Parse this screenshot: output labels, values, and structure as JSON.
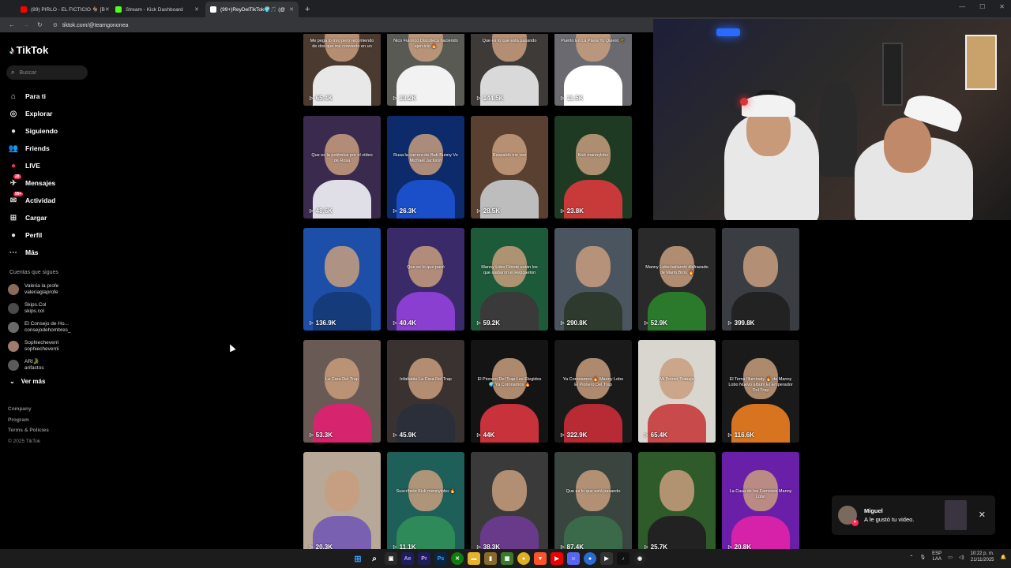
{
  "browser": {
    "tabs": [
      {
        "title": "(89) PIRLO - EL FICTICIO 🐐 [B",
        "favicon_color": "#ff0000",
        "active": false
      },
      {
        "title": "Stream - Kick Dashboard",
        "favicon_color": "#53fc18",
        "active": false
      },
      {
        "title": "(99+)ReyDelTikTok🌍🎵 (@",
        "favicon_color": "#ffffff",
        "active": true
      }
    ],
    "new_tab": "+",
    "url": "tiktok.com/@teamgononea"
  },
  "tiktok": {
    "logo": "TikTok",
    "search_placeholder": "Buscar",
    "nav": [
      {
        "label": "Para ti",
        "icon": "home-icon",
        "glyph": "⌂"
      },
      {
        "label": "Explorar",
        "icon": "compass-icon",
        "glyph": "◎"
      },
      {
        "label": "Siguiendo",
        "icon": "following-icon",
        "glyph": "●"
      },
      {
        "label": "Friends",
        "icon": "friends-icon",
        "glyph": "👥"
      },
      {
        "label": "LIVE",
        "icon": "live-icon",
        "glyph": "●"
      },
      {
        "label": "Mensajes",
        "icon": "messages-icon",
        "glyph": "✈",
        "badge": "28"
      },
      {
        "label": "Actividad",
        "icon": "activity-icon",
        "glyph": "✉",
        "badge": "99+"
      },
      {
        "label": "Cargar",
        "icon": "upload-icon",
        "glyph": "⊞"
      },
      {
        "label": "Perfil",
        "icon": "profile-icon",
        "glyph": "●"
      },
      {
        "label": "Más",
        "icon": "more-icon",
        "glyph": "···"
      }
    ],
    "following_title": "Cuentas que sigues",
    "following": [
      {
        "name": "Valeria la profe",
        "handle": "valeriaglaprofe"
      },
      {
        "name": "Skips.Col",
        "handle": "skips.col"
      },
      {
        "name": "El Consejo de Ho...",
        "handle": "consejodehombres_"
      },
      {
        "name": "Sophiecheverri",
        "handle": "sophiecheverrii"
      },
      {
        "name": "ARI🐊",
        "handle": "arifactos"
      }
    ],
    "ver_mas": "Ver más",
    "footer": [
      "Company",
      "Program",
      "Terms & Policies"
    ],
    "copyright": "© 2025 TikTok"
  },
  "videos": [
    {
      "views": "65.4K",
      "caption": "Me pega lo mío pero recomiendo de dos que me convierto en un",
      "bg": "#4a3a30",
      "shirt": "#e8e8e8"
    },
    {
      "views": "13.2K",
      "caption": "Nico Fulonco Discoteca haciendo ejercicio 🔥",
      "bg": "#5a5a55",
      "shirt": "#f2f2f2"
    },
    {
      "views": "144.5K",
      "caption": "Que es lo que está pasando",
      "bg": "#3e3a38",
      "shirt": "#d9d9d9"
    },
    {
      "views": "11.5K",
      "caption": "Puerto En La Playa Yo Quiero 🌴",
      "bg": "#6a6a70",
      "shirt": "#ffffff"
    },
    {
      "views": "48.6K",
      "caption": "Que es la polémica por el vídeo de Rosa",
      "bg": "#3a2a4e",
      "shirt": "#e0dfe8"
    },
    {
      "views": "26.3K",
      "caption": "Rusa la carrera de Bab Bunny Vs Michael Jackson",
      "bg": "#0d2a6b",
      "shirt": "#1b4fc9"
    },
    {
      "views": "28.5K",
      "caption": "Respaldo me veo",
      "bg": "#5a4030",
      "shirt": "#bdbdbd"
    },
    {
      "views": "23.8K",
      "caption": "Kick mannylobo",
      "bg": "#1f3a22",
      "shirt": "#c83a3a"
    },
    {
      "views": "136.9K",
      "caption": "",
      "bg": "#1d4fa8",
      "shirt": "#163b7a"
    },
    {
      "views": "40.4K",
      "caption": "Que es lo que pasó",
      "bg": "#3b2a6a",
      "shirt": "#8a3fd1"
    },
    {
      "views": "59.2K",
      "caption": "Manny Lobo Dónde están los que alabaron el Reggaeton",
      "bg": "#1d5a3a",
      "shirt": "#3a3a3a"
    },
    {
      "views": "290.8K",
      "caption": "",
      "bg": "#4a5560",
      "shirt": "#2d3a2d"
    },
    {
      "views": "52.9K",
      "caption": "Manny Lobo bailando disfrazado de Mario Bros 🔥",
      "bg": "#2a2a2a",
      "shirt": "#2b7a2b"
    },
    {
      "views": "399.8K",
      "caption": "",
      "bg": "#3a3d42",
      "shirt": "#222"
    },
    {
      "views": "53.3K",
      "caption": "La Cara Del Trap",
      "bg": "#6a5a55",
      "shirt": "#d6246e"
    },
    {
      "views": "45.9K",
      "caption": "Infaltable La Cara Del Trap",
      "bg": "#3a3230",
      "shirt": "#2a2f3a"
    },
    {
      "views": "44K",
      "caption": "El Pionero Del Trap Los Elegidos 🌍 Ya Coronamos 🔥",
      "bg": "#141414",
      "shirt": "#c8323a"
    },
    {
      "views": "322.9K",
      "caption": "Ya Coronamos 🔥 Manny Lobo El Pionero Del Trap",
      "bg": "#1a1a1a",
      "shirt": "#b82a34"
    },
    {
      "views": "65.4K",
      "caption": "Mi Primer Trabajo",
      "bg": "#d9d6d0",
      "shirt": "#c94a4a"
    },
    {
      "views": "116.6K",
      "caption": "El Tema Illuminaty 🔥 de Manny Lobo Nuevo álbum El Emperador Del Trap",
      "bg": "#1a1a1a",
      "shirt": "#d8741f"
    },
    {
      "views": "20.3K",
      "caption": "",
      "bg": "#b8a898",
      "shirt": "#7a60b0"
    },
    {
      "views": "11.1K",
      "caption": "Suscríbete Kick mannylobo 🔥",
      "bg": "#1f5f5a",
      "shirt": "#2f8a5a"
    },
    {
      "views": "38.3K",
      "caption": "",
      "bg": "#3a3a3a",
      "shirt": "#6a3a8a"
    },
    {
      "views": "87.4K",
      "caption": "Que es lo que está pasando",
      "bg": "#3a4540",
      "shirt": "#3a6a4a"
    },
    {
      "views": "25.7K",
      "caption": "",
      "bg": "#2f5a2a",
      "shirt": "#222"
    },
    {
      "views": "20.8K",
      "caption": "La Casa de los Famosos Manny Lobo",
      "bg": "#6a1fa8",
      "shirt": "#d622a8"
    }
  ],
  "notification": {
    "name": "Miguel",
    "text": "A le gustó tu video."
  },
  "taskbar": {
    "lang_top": "ESP",
    "lang_bottom": "LAA",
    "time": "10:22 p. m.",
    "date": "21/11/2025"
  },
  "colors": {
    "background": "#000000",
    "tiktok_red": "#fe2c55",
    "tiktok_cyan": "#25f4ee"
  }
}
